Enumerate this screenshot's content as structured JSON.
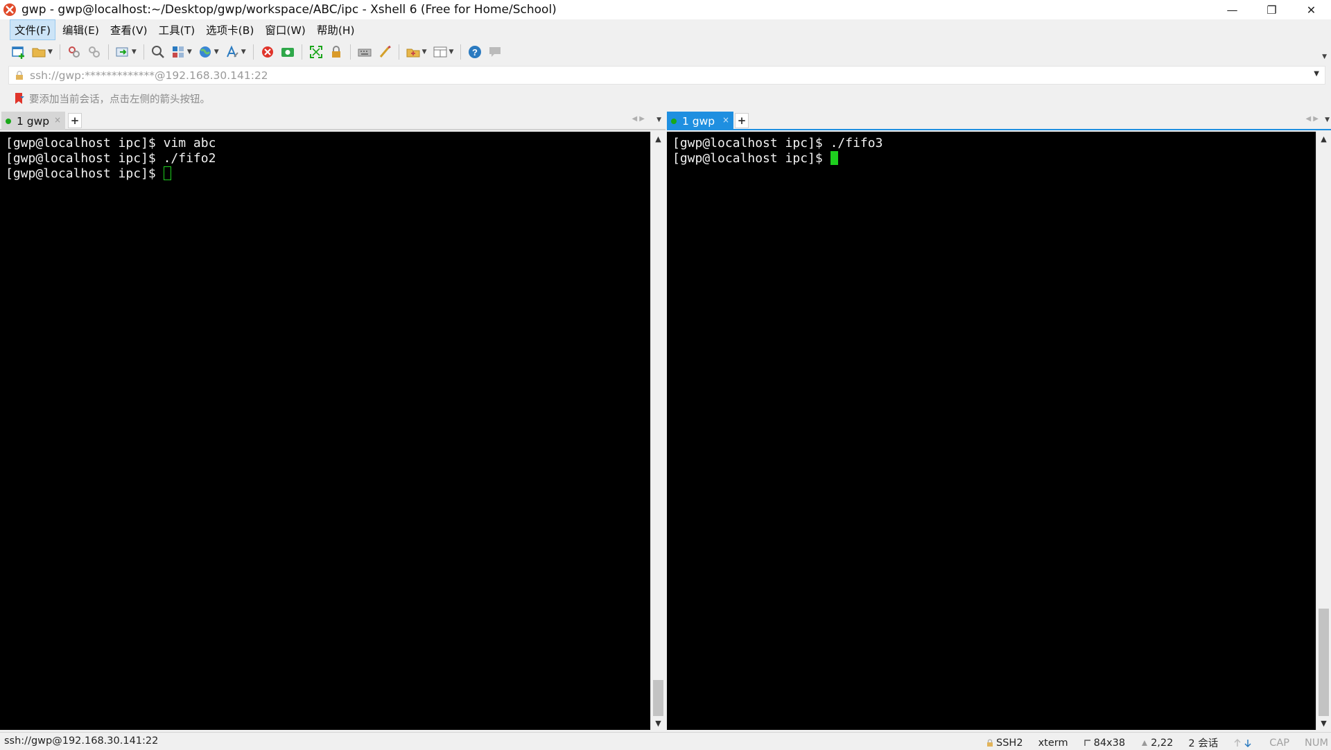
{
  "window": {
    "title": "gwp - gwp@localhost:~/Desktop/gwp/workspace/ABC/ipc - Xshell 6 (Free for Home/School)",
    "controls": {
      "minimize": "—",
      "restore": "❐",
      "close": "✕"
    }
  },
  "menu": {
    "items": [
      "文件(F)",
      "编辑(E)",
      "查看(V)",
      "工具(T)",
      "选项卡(B)",
      "窗口(W)",
      "帮助(H)"
    ],
    "active_index": 0
  },
  "toolbar": {
    "icons": [
      "new-session-icon",
      "open-folder-icon",
      "reconnect-icon",
      "disconnect-icon",
      "transfer-icon",
      "find-icon",
      "layout-icon",
      "globe-icon",
      "font-icon",
      "xshell-icon",
      "xftp-icon",
      "fullscreen-icon",
      "lock-icon",
      "keyboard-icon",
      "script-icon",
      "compose-icon",
      "tile-icon",
      "help-icon",
      "chat-icon"
    ]
  },
  "address": {
    "text": "ssh://gwp:*************@192.168.30.141:22"
  },
  "hint": {
    "text": "要添加当前会话，点击左侧的箭头按钮。"
  },
  "left_pane": {
    "tab_label": "1 gwp",
    "tab_close": "×",
    "tab_add": "+",
    "lines": [
      "[gwp@localhost ipc]$ vim abc",
      "[gwp@localhost ipc]$ ./fifo2",
      "[gwp@localhost ipc]$ "
    ]
  },
  "right_pane": {
    "tab_label": "1 gwp",
    "tab_close": "×",
    "tab_add": "+",
    "lines": [
      "[gwp@localhost ipc]$ ./fifo3",
      "[gwp@localhost ipc]$ "
    ]
  },
  "status": {
    "connection": "ssh://gwp@192.168.30.141:22",
    "protocol": "SSH2",
    "terminal": "xterm",
    "size": "84x38",
    "position": "2,22",
    "sessions": "2 会话",
    "cap": "CAP",
    "num": "NUM"
  },
  "colors": {
    "accent_tab": "#1f8fe0",
    "cursor": "#1ecf1e",
    "terminal_bg": "#000000",
    "terminal_fg": "#f2f2f2"
  }
}
